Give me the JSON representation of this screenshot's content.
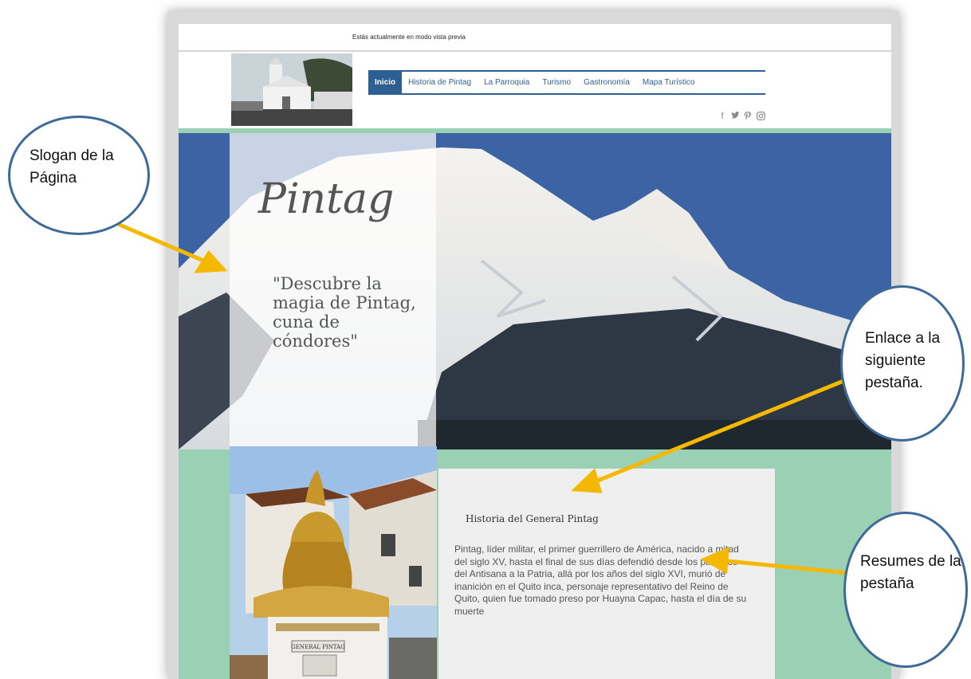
{
  "preview_notice": "Estás actualmente en modo vista previa",
  "nav": {
    "items": [
      "Inicio",
      "Historia de Pintag",
      "La Parroquia",
      "Turismo",
      "Gastronomía",
      "Mapa Turístico"
    ]
  },
  "social": [
    "f",
    "🐦",
    "P",
    "◎"
  ],
  "hero": {
    "title": "Pintag",
    "slogan": "\"Descubre la magia de Pintag, cuna de cóndores\""
  },
  "card": {
    "title": "Historia del General Pintag",
    "text": "Pintag, líder militar, el primer guerrillero de América, nacido a mitad del siglo XV, hasta el final de sus días defendió desde los páramos del Antisana a la Patria, allá por los años del siglo XVI, murió de inanición en el Quito inca, personaje representativo del Reino de Quito, quien fue tomado preso por Huayna Capac, hasta el día de su muerte"
  },
  "statue": {
    "plaque": "GENERAL PINTAG"
  },
  "annotations": {
    "slogan": "Slogan de la Página",
    "link": "Enlace a la siguiente pestaña.",
    "summary": "Resumes de la pestaña"
  },
  "colors": {
    "nav_blue": "#2e5f93",
    "teal": "#9ad0b4",
    "arrow": "#f5b800",
    "bubble_border": "#3d6a98"
  }
}
